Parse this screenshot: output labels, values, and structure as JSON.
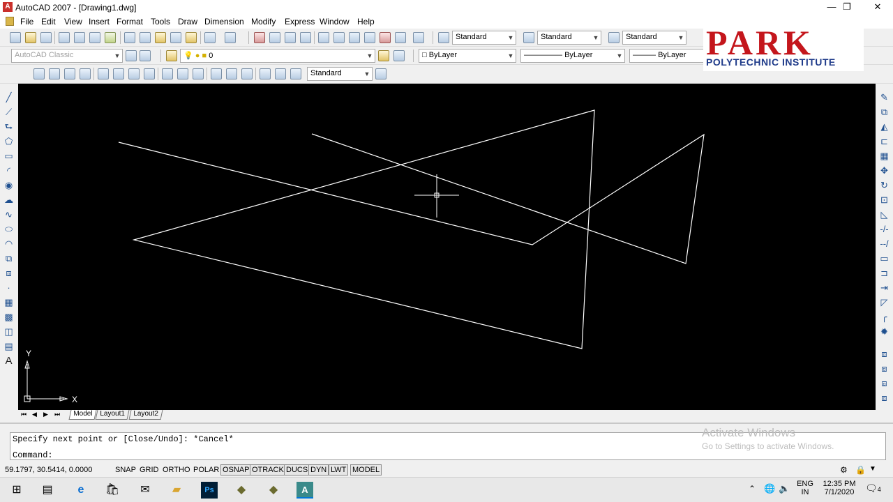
{
  "window": {
    "title": "AutoCAD 2007 - [Drawing1.dwg]",
    "app_icon": "A",
    "controls": [
      "—",
      "❐",
      "✕"
    ]
  },
  "menu": [
    "File",
    "Edit",
    "View",
    "Insert",
    "Format",
    "Tools",
    "Draw",
    "Dimension",
    "Modify",
    "Express",
    "Window",
    "Help"
  ],
  "styles": {
    "text_style": "Standard",
    "dim_style": "Standard",
    "table_style": "Standard"
  },
  "workspace": "AutoCAD Classic",
  "layer": "0",
  "properties": {
    "color": "ByLayer",
    "linetype": "ByLayer",
    "lineweight": "ByLayer",
    "plot_style": "ByColor"
  },
  "dim_toolbar_style": "Standard",
  "logo": {
    "main": "PARK",
    "sub": "POLYTECHNIC INSTITUTE"
  },
  "ucs": {
    "x_label": "X",
    "y_label": "Y"
  },
  "layout_tabs": [
    "Model",
    "Layout1",
    "Layout2"
  ],
  "command": {
    "history": "Specify next point or [Close/Undo]: *Cancel*",
    "prompt": "Command:"
  },
  "watermark": {
    "line1": "Activate Windows",
    "line2": "Go to Settings to activate Windows."
  },
  "status": {
    "coordinates": "59.1797, 30.5414, 0.0000",
    "toggles": [
      "SNAP",
      "GRID",
      "ORTHO",
      "POLAR",
      "OSNAP",
      "OTRACK",
      "DUCS",
      "DYN",
      "LWT",
      "MODEL"
    ],
    "on": [
      "OSNAP",
      "OTRACK",
      "DUCS",
      "DYN",
      "LWT",
      "MODEL"
    ]
  },
  "taskbar": {
    "language": "ENG",
    "region": "IN",
    "time": "12:35 PM",
    "date": "7/1/2020",
    "notifications": "4"
  },
  "colors": {
    "canvas": "#000000",
    "drawing_line": "#ffffff",
    "logo_red": "#c4161c",
    "logo_blue": "#1f3b8a"
  }
}
